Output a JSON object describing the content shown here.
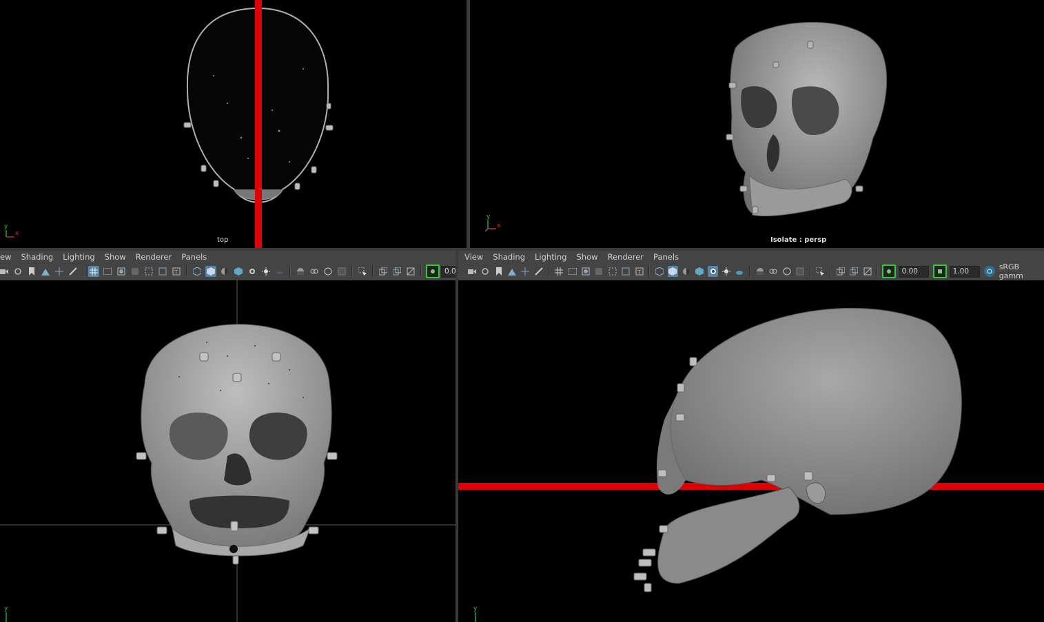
{
  "viewports": {
    "top": {
      "label": "top",
      "axis_y": "y",
      "axis_x": "x"
    },
    "persp": {
      "label": "Isolate : persp",
      "axis_y": "y",
      "axis_x": "x"
    },
    "front": {
      "axis_y": "y"
    },
    "side": {
      "axis_y": "y"
    }
  },
  "left_panel": {
    "menu": {
      "view": "ew",
      "shading": "Shading",
      "lighting": "Lighting",
      "show": "Show",
      "renderer": "Renderer",
      "panels": "Panels"
    },
    "exposure_value": "0.0"
  },
  "right_panel": {
    "menu": {
      "view": "View",
      "shading": "Shading",
      "lighting": "Lighting",
      "show": "Show",
      "renderer": "Renderer",
      "panels": "Panels"
    },
    "exposure_value": "0.00",
    "gamma_value": "1.00",
    "color_space": "sRGB gamm"
  },
  "colors": {
    "viewport_bg": "#000000",
    "panel_bg": "#444444",
    "active_button": "#5285a6",
    "manipulator_red": "#e00000",
    "mesh_gray": "#8f8f8f",
    "axis_y": "#2bc22b",
    "axis_x": "#d83030"
  },
  "icons": {
    "camera": "camera-icon",
    "grid": "grid-icon",
    "wireframe": "wireframe-cube-icon",
    "smooth_shade": "shaded-cube-icon",
    "isolate": "isolate-icon",
    "xray": "xray-icon",
    "exposure": "exposure-icon",
    "gamma": "gamma-icon",
    "color_management": "color-management-icon"
  }
}
